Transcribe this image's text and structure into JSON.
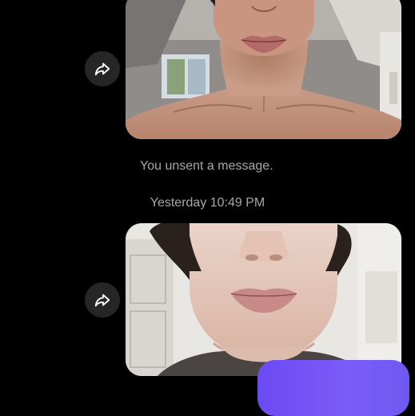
{
  "conversation": {
    "messages": [
      {
        "type": "photo",
        "subject": "neck-and-lips-photo"
      },
      {
        "type": "system",
        "text": "You unsent a message."
      },
      {
        "type": "timestamp",
        "text": "Yesterday 10:49 PM"
      },
      {
        "type": "photo",
        "subject": "face-closeup-photo"
      },
      {
        "type": "outgoing",
        "text": ""
      }
    ]
  },
  "icons": {
    "share": "share-arrow-icon"
  },
  "colors": {
    "background": "#000000",
    "share_button_bg": "#262626",
    "secondary_text": "#a8a8a8",
    "outgoing_bubble": "#7258f5"
  }
}
